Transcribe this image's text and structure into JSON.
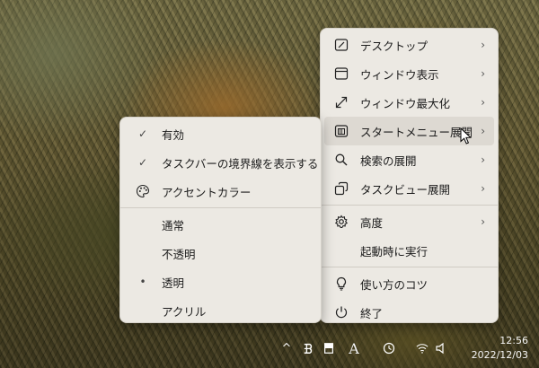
{
  "main_menu": {
    "items": [
      {
        "label": "デスクトップ",
        "icon": "desktop-icon",
        "submenu": true
      },
      {
        "label": "ウィンドウ表示",
        "icon": "window-icon",
        "submenu": true
      },
      {
        "label": "ウィンドウ最大化",
        "icon": "maximize-icon",
        "submenu": true
      },
      {
        "label": "スタートメニュー展開",
        "icon": "start-menu-icon",
        "submenu": true,
        "hover": true
      },
      {
        "label": "検索の展開",
        "icon": "search-icon",
        "submenu": true
      },
      {
        "label": "タスクビュー展開",
        "icon": "task-view-icon",
        "submenu": true
      },
      {
        "label": "高度",
        "icon": "gear-icon",
        "submenu": true
      },
      {
        "label": "起動時に実行",
        "icon": "",
        "submenu": false
      },
      {
        "label": "使い方のコツ",
        "icon": "lightbulb-icon",
        "submenu": false
      },
      {
        "label": "終了",
        "icon": "power-icon",
        "submenu": false
      }
    ]
  },
  "sub_menu": {
    "items": [
      {
        "label": "有効",
        "mark": "✓"
      },
      {
        "label": "タスクバーの境界線を表示する",
        "mark": "✓"
      },
      {
        "label": "アクセントカラー",
        "mark": "palette-icon"
      },
      {
        "label": "通常",
        "mark": ""
      },
      {
        "label": "不透明",
        "mark": ""
      },
      {
        "label": "透明",
        "mark": "•"
      },
      {
        "label": "アクリル",
        "mark": ""
      }
    ]
  },
  "taskbar": {
    "chevron": "^",
    "font_icon_glyph": "A",
    "clock_time": "12:56",
    "clock_date": "2022/12/03"
  },
  "colors": {
    "menu_bg": "#ece9e3",
    "hover_bg": "#ddd9d2",
    "text": "#1c1c1c"
  }
}
